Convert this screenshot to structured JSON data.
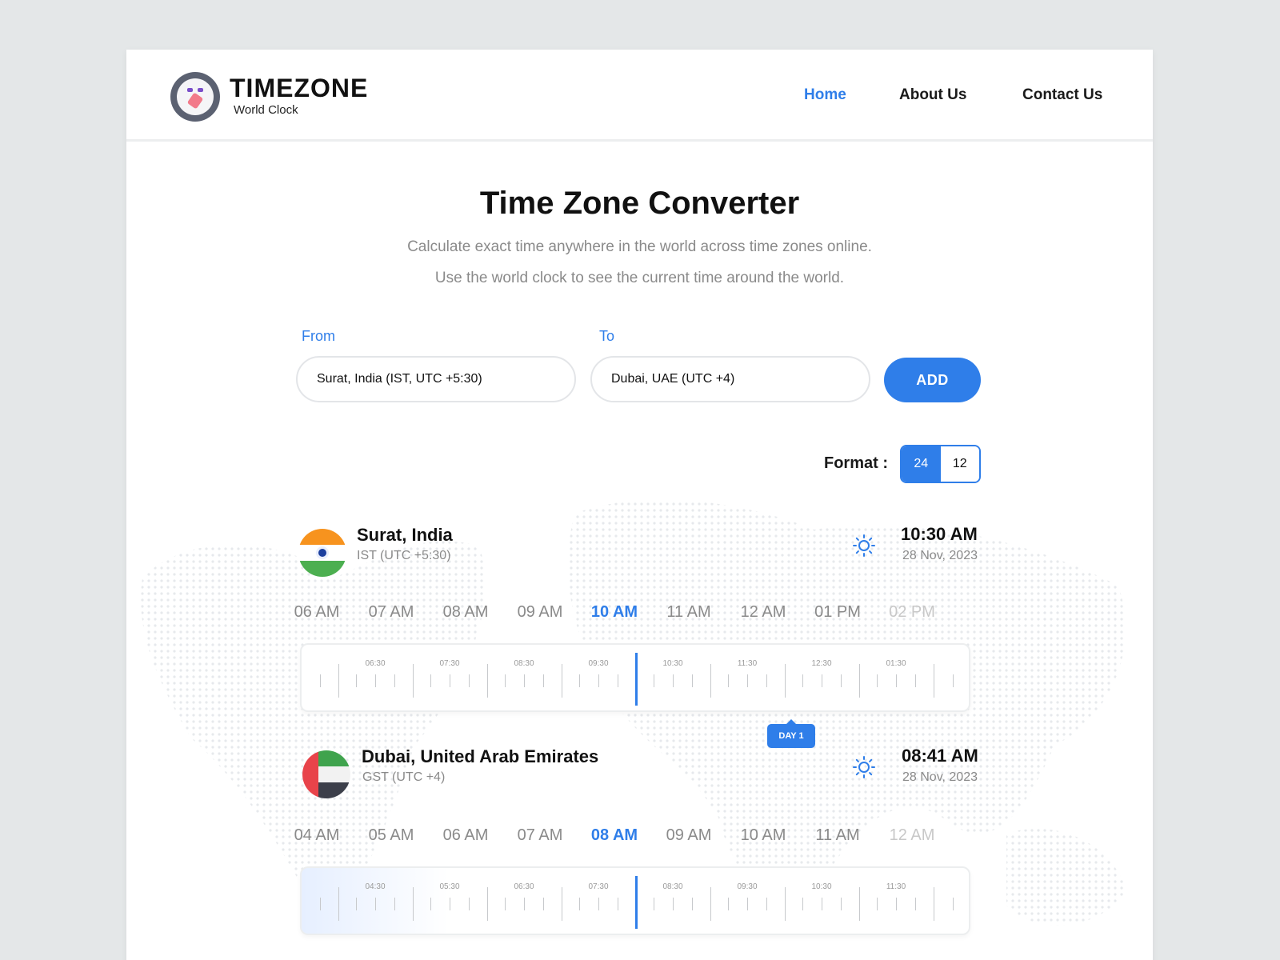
{
  "brand": {
    "title": "TIMEZONE",
    "subtitle": "World Clock"
  },
  "nav": [
    {
      "label": "Home",
      "active": true
    },
    {
      "label": "About Us",
      "active": false
    },
    {
      "label": "Contact Us",
      "active": false
    }
  ],
  "hero": {
    "title": "Time Zone Converter",
    "line1": "Calculate exact time anywhere in the world across time zones online.",
    "line2": "Use the world clock to see the current time around the world."
  },
  "form": {
    "from_label": "From",
    "from_value": "Surat, India (IST, UTC +5:30)",
    "to_label": "To",
    "to_value": "Dubai, UAE (UTC +4)",
    "add_label": "ADD"
  },
  "format": {
    "label": "Format :",
    "options": [
      "24",
      "12"
    ],
    "selected": "24"
  },
  "zones": [
    {
      "city": "Surat, India",
      "zone": "IST (UTC +5:30)",
      "time": "10:30 AM",
      "date": "28 Nov, 2023",
      "hours": [
        "06 AM",
        "07 AM",
        "08 AM",
        "09 AM",
        "10 AM",
        "11 AM",
        "12 AM",
        "01 PM",
        "02 PM"
      ],
      "current_hour": "10 AM",
      "tick_labels": [
        "06:30",
        "07:30",
        "08:30",
        "09:30",
        "10:30",
        "11:30",
        "12:30",
        "01:30"
      ]
    },
    {
      "city": "Dubai, United Arab Emirates",
      "zone": "GST (UTC +4)",
      "time": "08:41 AM",
      "date": "28 Nov, 2023",
      "hours": [
        "04 AM",
        "05 AM",
        "06 AM",
        "07 AM",
        "08 AM",
        "09 AM",
        "10 AM",
        "11 AM",
        "12 AM"
      ],
      "current_hour": "08 AM",
      "tick_labels": [
        "04:30",
        "05:30",
        "06:30",
        "07:30",
        "08:30",
        "09:30",
        "10:30",
        "11:30"
      ]
    }
  ],
  "day_badge": "DAY 1",
  "colors": {
    "accent": "#2f7ee9",
    "text": "#111111",
    "muted": "#8a8a8a"
  }
}
